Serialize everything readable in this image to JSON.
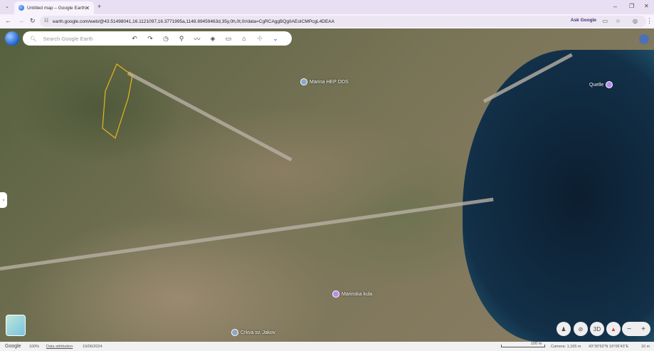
{
  "browser": {
    "tab_title": "Untitled map – Google Earth",
    "url": "earth.google.com/web/@43.51498041,16.1121097,16.3771995a,1148.89459463d,35y,0h,0t,0r/data=CgRCAggBQgIIAEoICMPcgL4DEAA",
    "ask_google": "Ask Google"
  },
  "toolbar": {
    "search_placeholder": "Search Google Earth"
  },
  "map": {
    "labels": [
      {
        "name": "Marina HEP ODS"
      },
      {
        "name": "Quelle"
      },
      {
        "name": "Marinska kula"
      },
      {
        "name": "Crkva sv. Jakov"
      }
    ],
    "controls": {
      "tilt": "3D"
    }
  },
  "status": {
    "brand": "Google",
    "zoom": "100%",
    "attribution": "Data attribution",
    "date": "19/06/2024",
    "scale": "100 m",
    "camera": "Camera: 1,165 m",
    "coords": "43°30'53\"N 16°06'43\"E",
    "elevation": "16 m"
  }
}
